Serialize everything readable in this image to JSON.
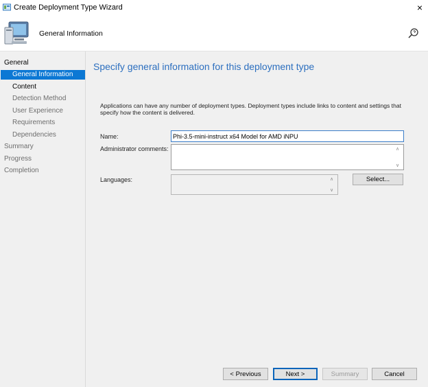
{
  "window": {
    "title": "Create Deployment Type Wizard",
    "close_icon": "×"
  },
  "header": {
    "title": "General Information"
  },
  "nav": {
    "items": [
      {
        "label": "General"
      },
      {
        "label": "General Information"
      },
      {
        "label": "Content"
      },
      {
        "label": "Detection Method"
      },
      {
        "label": "User Experience"
      },
      {
        "label": "Requirements"
      },
      {
        "label": "Dependencies"
      },
      {
        "label": "Summary"
      },
      {
        "label": "Progress"
      },
      {
        "label": "Completion"
      }
    ]
  },
  "main": {
    "title": "Specify general information for this deployment type",
    "description": "Applications can have any number of deployment types. Deployment types include links to content and settings that specify how the content is delivered.",
    "name_label": "Name:",
    "name_value": "Phi-3.5-mini-instruct x64 Model for AMD iNPU",
    "comments_label": "Administrator comments:",
    "comments_value": "",
    "languages_label": "Languages:",
    "select_button": "Select..."
  },
  "footer": {
    "previous": "< Previous",
    "next": "Next >",
    "summary": "Summary",
    "cancel": "Cancel"
  },
  "colors": {
    "accent": "#0c78d4",
    "title_blue": "#2c6fbf"
  }
}
